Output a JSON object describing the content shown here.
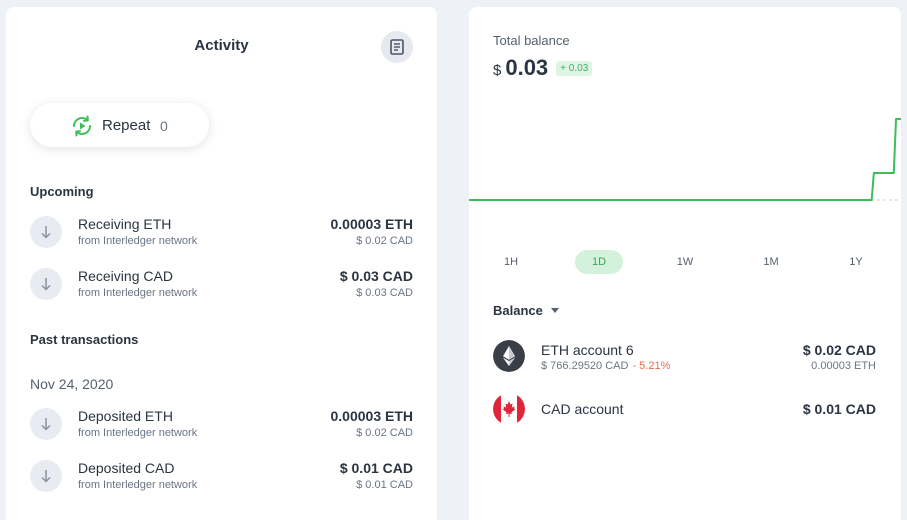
{
  "activity": {
    "title": "Activity",
    "repeat": {
      "label": "Repeat",
      "count": "0"
    },
    "upcoming_title": "Upcoming",
    "upcoming": [
      {
        "title": "Receiving ETH",
        "subtitle": "from Interledger network",
        "amount": "0.00003 ETH",
        "amount_secondary": "$ 0.02 CAD"
      },
      {
        "title": "Receiving CAD",
        "subtitle": "from Interledger network",
        "amount": "$ 0.03 CAD",
        "amount_secondary": "$ 0.03 CAD"
      }
    ],
    "past_title": "Past transactions",
    "past_date": "Nov 24, 2020",
    "past": [
      {
        "title": "Deposited ETH",
        "subtitle": "from Interledger network",
        "amount": "0.00003 ETH",
        "amount_secondary": "$ 0.02 CAD"
      },
      {
        "title": "Deposited CAD",
        "subtitle": "from Interledger network",
        "amount": "$ 0.01 CAD",
        "amount_secondary": "$ 0.01 CAD"
      }
    ]
  },
  "balance_panel": {
    "total_label": "Total balance",
    "currency_symbol": "$",
    "total_value": "0.03",
    "change": "+ 0.03",
    "ranges": [
      "1H",
      "1D",
      "1W",
      "1M",
      "1Y"
    ],
    "active_range": "1D",
    "balance_header": "Balance",
    "accounts": [
      {
        "name": "ETH account 6",
        "price": "$ 766.29520 CAD",
        "change": "- 5.21%",
        "amount": "$ 0.02 CAD",
        "amount_secondary": "0.00003 ETH",
        "icon": "ethereum-icon"
      },
      {
        "name": "CAD account",
        "price": "",
        "change": "",
        "amount": "$ 0.01 CAD",
        "amount_secondary": "",
        "icon": "canada-flag-icon"
      }
    ]
  },
  "chart_data": {
    "type": "line",
    "series": [
      {
        "values": [
          0,
          0,
          0,
          0,
          0,
          0,
          0,
          0,
          0,
          0,
          0,
          0,
          0,
          0,
          0,
          0,
          0,
          0,
          0,
          0,
          0,
          0,
          0,
          0,
          0,
          0,
          0,
          0,
          0,
          0,
          0,
          0,
          0,
          0,
          0,
          0,
          0,
          0.01,
          0.01,
          0.03
        ]
      }
    ],
    "baseline_dashed": true,
    "color": "#3bbf5a",
    "grid": false
  },
  "colors": {
    "accent_green": "#3bbf5a",
    "negative": "#ef6a4a",
    "background": "#eef1f6"
  }
}
